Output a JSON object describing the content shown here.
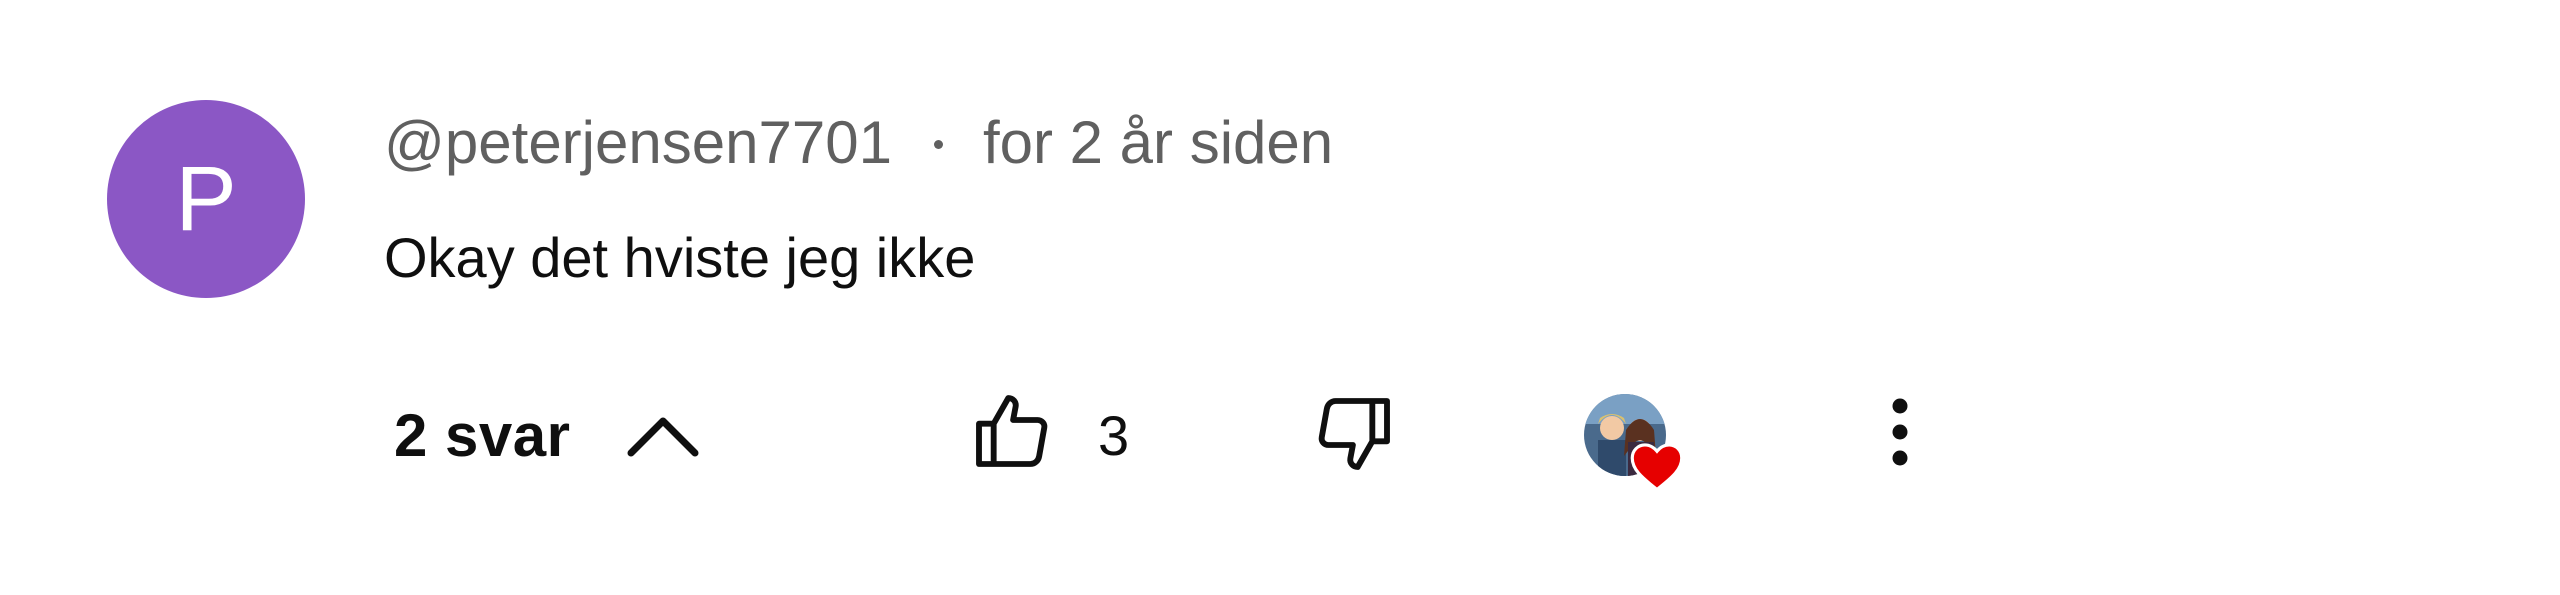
{
  "comment": {
    "avatar_letter": "P",
    "avatar_color": "#8b57c5",
    "handle": "@peterjensen7701",
    "timestamp": "for 2 år siden",
    "text": "Okay det hviste jeg ikke",
    "replies_label": "2 svar",
    "like_count": "3"
  },
  "icons": {
    "chevron": "chevron-up-icon",
    "like": "thumbs-up-icon",
    "dislike": "thumbs-down-icon",
    "creator_heart": "heart-icon",
    "more": "more-vert-icon"
  },
  "colors": {
    "heart": "#e60000",
    "secondary_text": "#606060",
    "primary_text": "#0f0f0f"
  }
}
